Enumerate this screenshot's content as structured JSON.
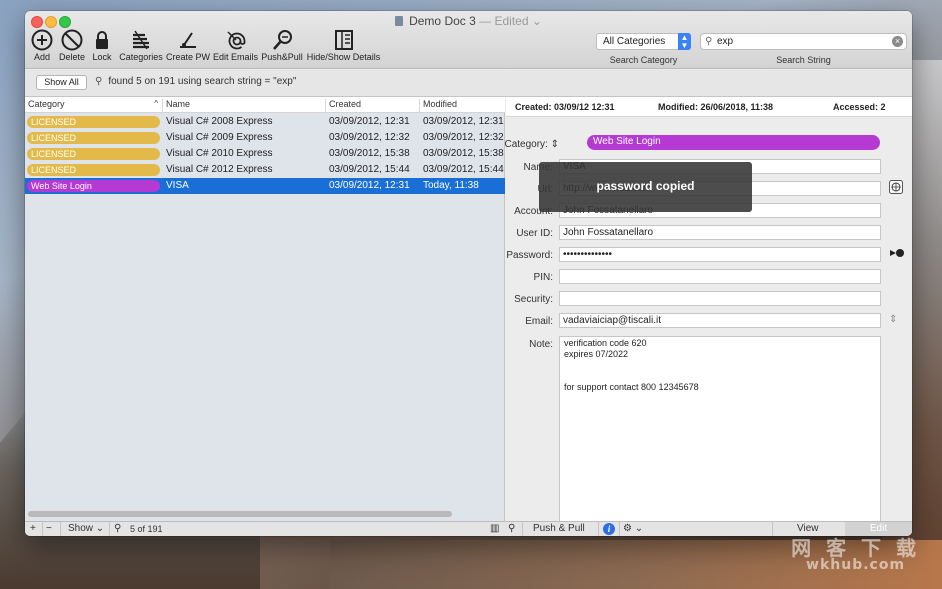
{
  "window": {
    "title": "Demo Doc 3",
    "edited_label": "— Edited ⌄"
  },
  "toolbar": {
    "items": [
      {
        "label": "Add",
        "icon": "add-circle-icon"
      },
      {
        "label": "Delete",
        "icon": "delete-circle-icon"
      },
      {
        "label": "Lock",
        "icon": "lock-icon"
      },
      {
        "label": "Categories",
        "icon": "categories-icon"
      },
      {
        "label": "Create PW",
        "icon": "create-password-icon"
      },
      {
        "label": "Edit Emails",
        "icon": "at-sign-icon"
      },
      {
        "label": "Push&Pull",
        "icon": "push-pull-icon"
      },
      {
        "label": "Hide/Show Details",
        "icon": "panel-toggle-icon"
      }
    ],
    "category_select": {
      "value": "All Categories",
      "label": "Search Category"
    },
    "search": {
      "value": "exp",
      "label": "Search String"
    }
  },
  "filterbar": {
    "show_all": "Show All",
    "found_text": "found 5 on 191 using  search string = \"exp\""
  },
  "table": {
    "columns": [
      "Category",
      "Name",
      "Created",
      "Modified"
    ],
    "rows": [
      {
        "category": "LICENSED",
        "category_color": "#e3b94a",
        "name": "Visual C# 2008 Express",
        "created": "03/09/2012, 12:31",
        "modified": "03/09/2012, 12:31",
        "selected": false
      },
      {
        "category": "LICENSED",
        "category_color": "#e3b94a",
        "name": "Visual C# 2009 Express",
        "created": "03/09/2012, 12:32",
        "modified": "03/09/2012, 12:32",
        "selected": false
      },
      {
        "category": "LICENSED",
        "category_color": "#e3b94a",
        "name": "Visual C# 2010 Express",
        "created": "03/09/2012, 15:38",
        "modified": "03/09/2012, 15:38",
        "selected": false
      },
      {
        "category": "LICENSED",
        "category_color": "#e3b94a",
        "name": "Visual C# 2012 Express",
        "created": "03/09/2012, 15:44",
        "modified": "03/09/2012, 15:44",
        "selected": false
      },
      {
        "category": "Web Site Login",
        "category_color": "#b43ad3",
        "name": "VISA",
        "created": "03/09/2012, 12:31",
        "modified": "Today, 11:38",
        "selected": true
      }
    ]
  },
  "detail": {
    "created": "Created:  03/09/12 12:31",
    "modified": "Modified:  26/06/2018, 11:38",
    "accessed": "Accessed:  2",
    "category_label": "Category:",
    "category_value": "Web Site Login",
    "fields": [
      {
        "label": "Name:",
        "value": "VISA"
      },
      {
        "label": "Url:",
        "value": "http://www.visa.com"
      },
      {
        "label": "Account:",
        "value": "John Fossatanellaro"
      },
      {
        "label": "User ID:",
        "value": "John Fossatanellaro"
      },
      {
        "label": "Password:",
        "value": "••••••••••••••"
      },
      {
        "label": "PIN:",
        "value": ""
      },
      {
        "label": "Security:",
        "value": ""
      },
      {
        "label": "Email:",
        "value": "vadaviaiciap@tiscali.it"
      }
    ],
    "note_label": "Note:",
    "note_lines": [
      "verification code 620",
      "expires 07/2022",
      "",
      "",
      "for support contact 800 12345678"
    ]
  },
  "hud": {
    "text": "password copied"
  },
  "bottombar": {
    "add": "+",
    "remove": "−",
    "show": "Show",
    "count": "5 of 191",
    "push_pull": "Push & Pull",
    "view": "View",
    "edit": "Edit"
  },
  "watermark": {
    "line1": "网 客 下 载",
    "line2": "wkhub.com"
  }
}
